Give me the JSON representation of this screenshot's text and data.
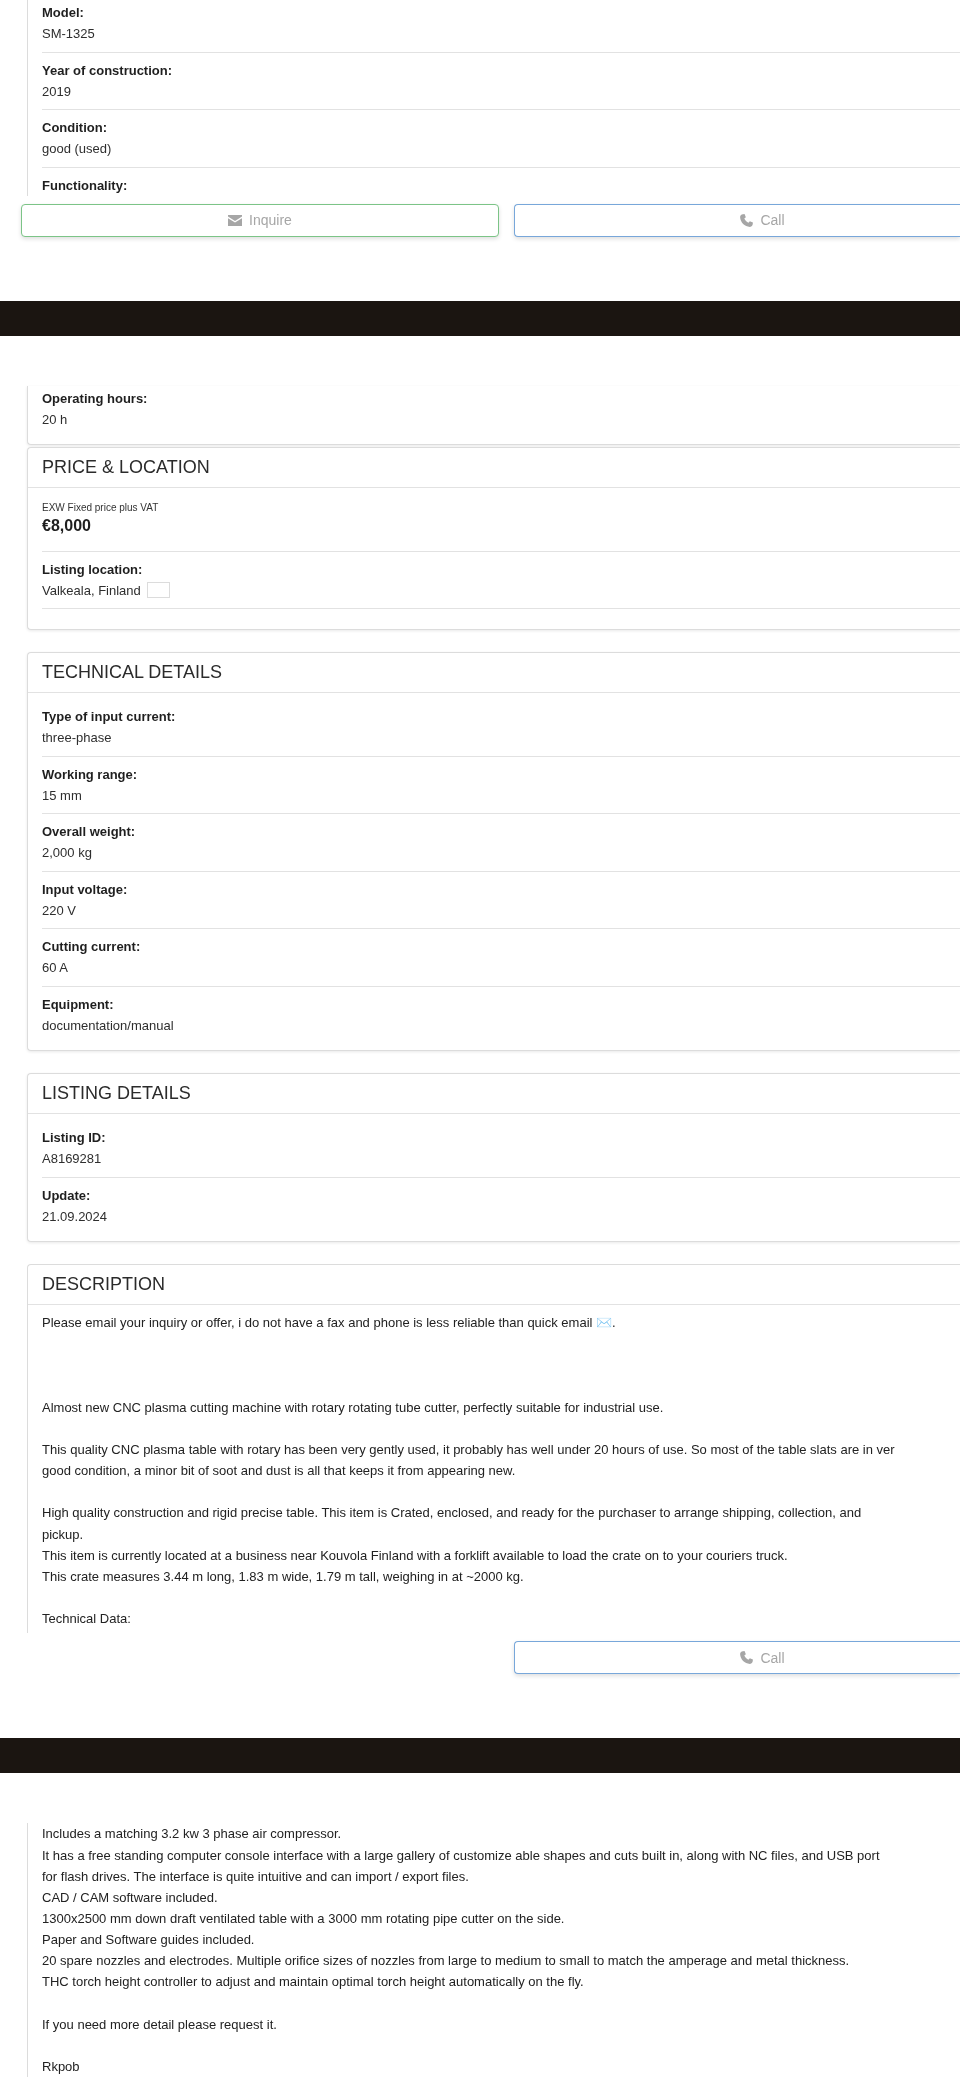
{
  "sections": [
    {
      "kind": "field_card",
      "rows": [
        {
          "label": "Model:",
          "value": "SM-1325"
        },
        {
          "label": "Year of construction:",
          "value": "2019"
        },
        {
          "label": "Condition:",
          "value": "good (used)"
        },
        {
          "label": "Functionality:"
        }
      ]
    },
    {
      "kind": "action_bar",
      "buttons": [
        {
          "kind": "inquire",
          "label": "Inquire"
        },
        {
          "kind": "call",
          "label": "Call"
        }
      ]
    },
    {
      "kind": "dark_band"
    },
    {
      "kind": "field_card",
      "rows": [
        {
          "label": "Operating hours:",
          "value": "20 h"
        }
      ]
    },
    {
      "kind": "price_card",
      "title": "PRICE & LOCATION",
      "price_note": "EXW Fixed price plus VAT",
      "price": "€8,000",
      "location_label": "Listing location:",
      "location": "Valkeala, Finland"
    },
    {
      "kind": "field_card",
      "title": "TECHNICAL DETAILS",
      "rows": [
        {
          "label": "Type of input current:",
          "value": "three-phase"
        },
        {
          "label": "Working range:",
          "value": "15 mm"
        },
        {
          "label": "Overall weight:",
          "value": "2,000 kg"
        },
        {
          "label": "Input voltage:",
          "value": "220 V"
        },
        {
          "label": "Cutting current:",
          "value": "60 A"
        },
        {
          "label": "Equipment:",
          "value": "documentation/manual"
        }
      ]
    },
    {
      "kind": "field_card",
      "title": "LISTING DETAILS",
      "rows": [
        {
          "label": "Listing ID:",
          "value": "A8169281"
        },
        {
          "label": "Update:",
          "value": "21.09.2024"
        }
      ]
    },
    {
      "kind": "text_card",
      "title": "DESCRIPTION",
      "text": "Please email your inquiry or offer, i do not have a fax and phone is less reliable than quick email ✉️.\n\n\n\nAlmost new CNC plasma cutting machine with rotary rotating tube cutter, perfectly suitable for industrial use.\n\nThis quality CNC plasma table with rotary has been very gently used, it probably has well under 20 hours of use. So most of the table slats are in ver\ngood condition, a minor bit of soot and dust is all that keeps it from appearing new.\n\nHigh quality construction and rigid precise table. This item is Crated, enclosed, and ready for the purchaser to arrange shipping, collection, and\npickup.\nThis item is currently located at a business near Kouvola Finland with a forklift available to load the crate on to your couriers truck.\nThis crate measures 3.44 m long, 1.83 m wide, 1.79 m tall, weighing in at ~2000 kg.\n\nTechnical Data:"
    },
    {
      "kind": "action_bar",
      "buttons": [
        {
          "kind": "call",
          "label": "Call"
        }
      ]
    },
    {
      "kind": "dark_band"
    },
    {
      "kind": "text_card",
      "text": "Includes a matching 3.2 kw 3 phase air compressor.\nIt has a free standing computer console interface with a large gallery of customize able shapes and cuts built in, along with NC files, and USB port\nfor flash drives. The interface is quite intuitive and can import / export files.\nCAD / CAM software included.\n1300x2500 mm down draft ventilated table with a 3000 mm rotating pipe cutter on the side.\nPaper and Software guides included.\n20 spare nozzles and electrodes. Multiple orifice sizes of nozzles from large to medium to small to match the amperage and metal thickness.\nTHC torch height controller to adjust and maintain optimal torch height automatically on the fly.\n\nIf you need more detail please request it.\n\nRkpob"
    }
  ]
}
